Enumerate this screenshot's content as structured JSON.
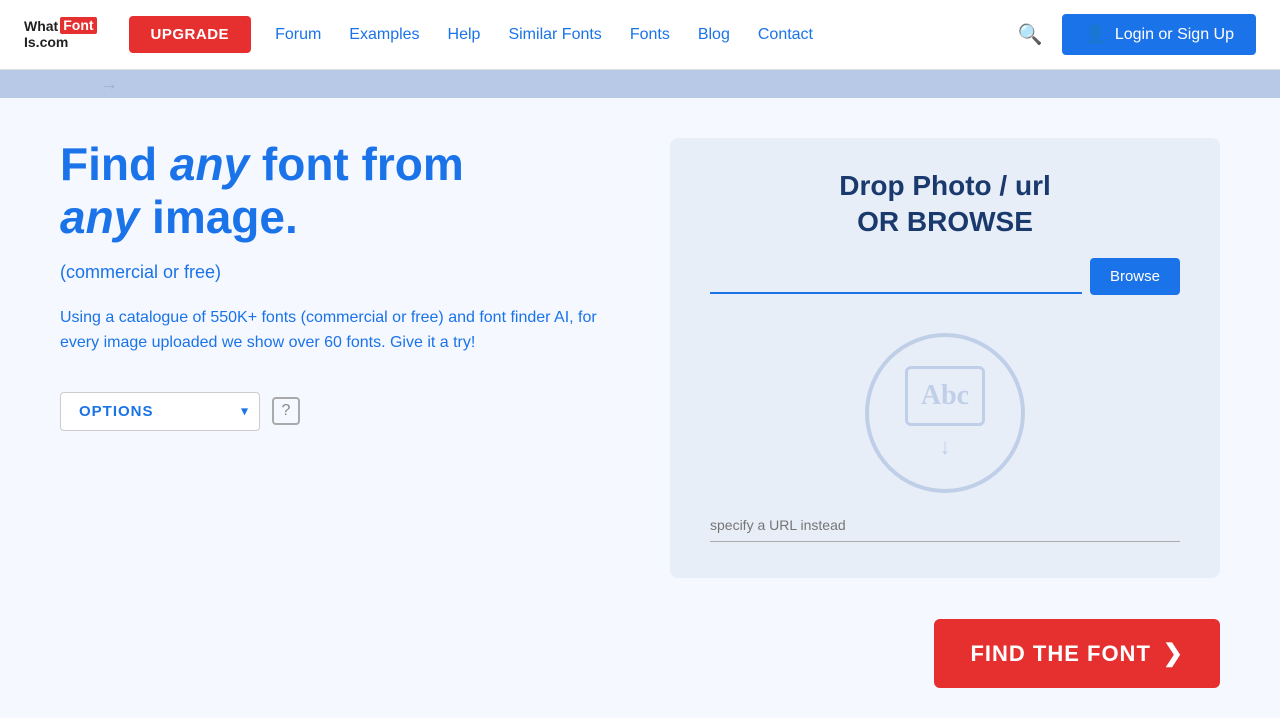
{
  "header": {
    "logo": {
      "what": "What",
      "font": "Font",
      "iscom": "Is.com"
    },
    "upgrade_label": "UPGRADE",
    "nav": {
      "forum": "Forum",
      "examples": "Examples",
      "help": "Help",
      "similar_fonts": "Similar Fonts",
      "fonts": "Fonts",
      "blog": "Blog",
      "contact": "Contact"
    },
    "login_label": "Login or Sign Up"
  },
  "main": {
    "heading_part1": "Find ",
    "heading_any1": "any",
    "heading_part2": " font from ",
    "heading_any2": "any",
    "heading_part3": " image.",
    "subtitle": "(commercial or free)",
    "description": "Using a catalogue of 550K+ fonts (commercial or free) and font finder AI, for every image uploaded we show over 60 fonts. Give it a try!",
    "options_label": "OPTIONS",
    "help_icon": "?",
    "drop": {
      "title": "Drop Photo / url",
      "or_browse": "OR BROWSE",
      "browse_btn": "Browse",
      "browse_placeholder": "",
      "url_placeholder": "specify a URL instead",
      "abc_text": "Abc"
    },
    "find_font_btn": "FIND THE FONT"
  }
}
